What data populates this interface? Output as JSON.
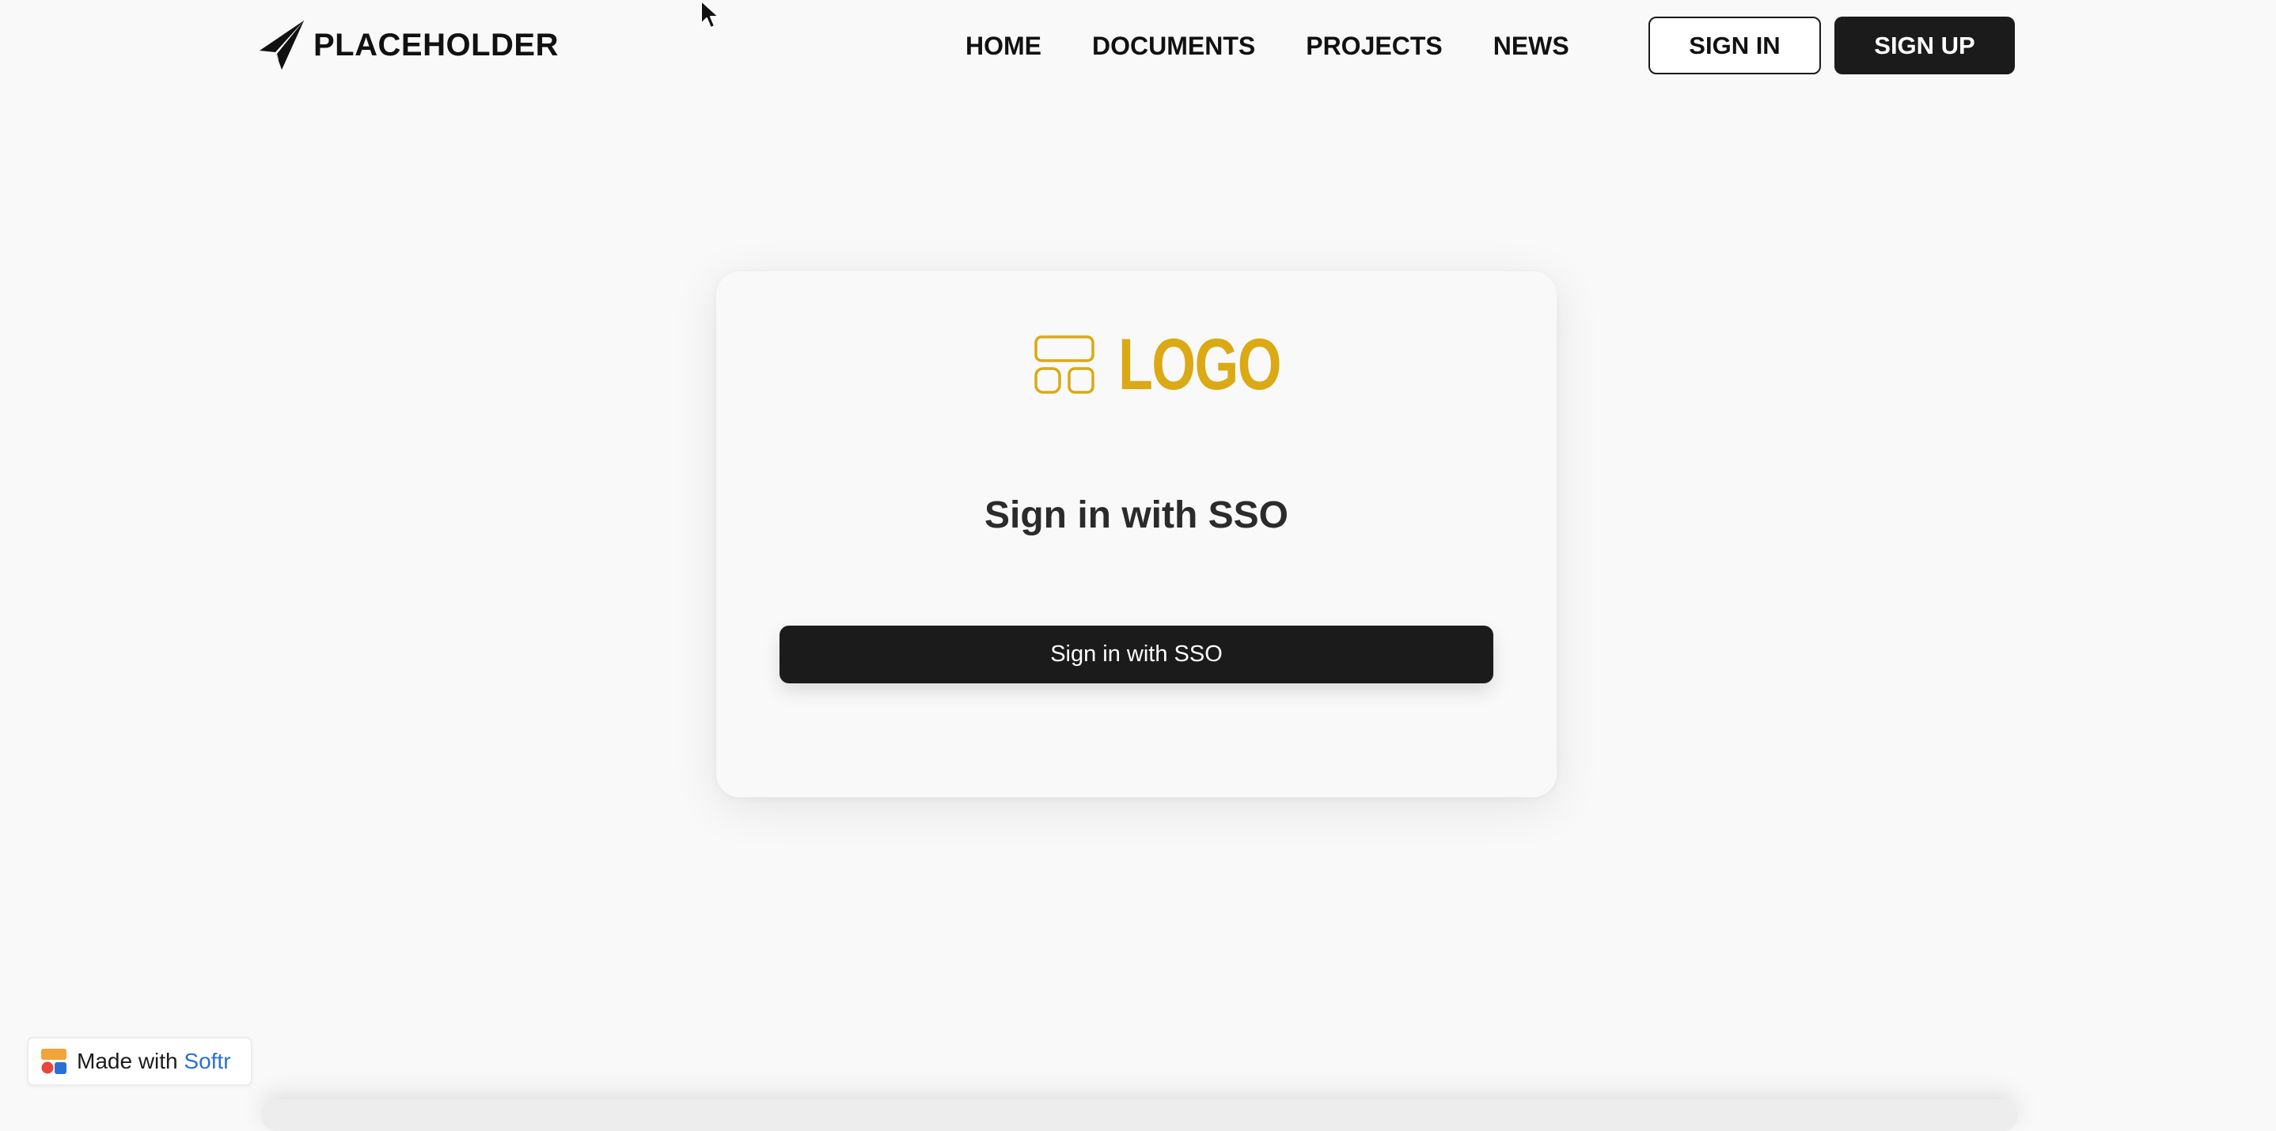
{
  "header": {
    "brand_name": "PLACEHOLDER",
    "nav": [
      {
        "label": "HOME"
      },
      {
        "label": "DOCUMENTS"
      },
      {
        "label": "PROJECTS"
      },
      {
        "label": "NEWS"
      }
    ],
    "sign_in_label": "SIGN IN",
    "sign_up_label": "SIGN UP"
  },
  "card": {
    "logo_text": "LOGO",
    "heading": "Sign in with SSO",
    "sso_button_label": "Sign in with SSO"
  },
  "badge": {
    "prefix": "Made with",
    "brand": "Softr"
  },
  "colors": {
    "accent_gold": "#dba913",
    "dark_button": "#1b1b1b",
    "page_background": "#f9f9f9",
    "softr_blue": "#2a6fd6"
  },
  "icons": {
    "brand_logo": "paper-plane-icon",
    "card_logo": "layout-grid-icon",
    "badge_logo": "softr-logo-icon",
    "cursor": "mouse-pointer-icon"
  }
}
